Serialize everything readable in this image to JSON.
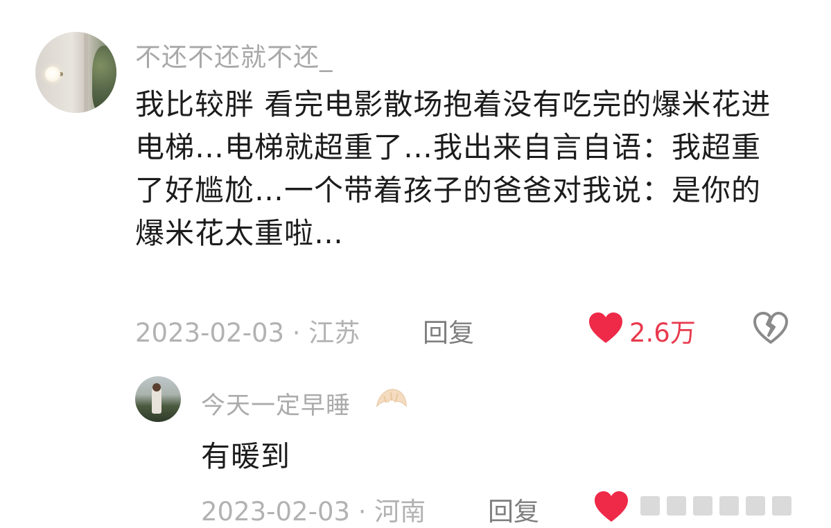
{
  "main_comment": {
    "username": "不还不还就不还_",
    "text": "我比较胖 看完电影散场抱着没有吃完的爆米花进电梯…电梯就超重了…我出来自言自语：我超重了好尴尬…一个带着孩子的爸爸对我说：是你的爆米花太重啦…",
    "date_location": "2023-02-03 · 江苏",
    "reply_label": "回复",
    "like_count": "2.6万",
    "like_color": "#e8394d"
  },
  "sub_comment": {
    "username": "今天一定早睡",
    "username_emoji": "croissant-emoji",
    "text": "有暖到",
    "date_location": "2023-02-03 · 河南",
    "reply_label": "回复"
  }
}
